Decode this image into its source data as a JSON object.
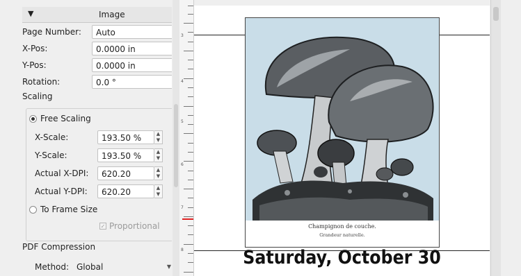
{
  "properties": {
    "section_title": "Image",
    "page_number_label": "Page Number:",
    "page_number_value": "Auto",
    "xpos_label": "X-Pos:",
    "xpos_value": "0.0000 in",
    "ypos_label": "Y-Pos:",
    "ypos_value": "0.0000 in",
    "rotation_label": "Rotation:",
    "rotation_value": "0.0 °",
    "scaling_label": "Scaling",
    "free_scaling_label": "Free Scaling",
    "xscale_label": "X-Scale:",
    "xscale_value": "193.50 %",
    "yscale_label": "Y-Scale:",
    "yscale_value": "193.50 %",
    "actual_xdpi_label": "Actual X-DPI:",
    "actual_xdpi_value": "620.20",
    "actual_ydpi_label": "Actual Y-DPI:",
    "actual_ydpi_value": "620.20",
    "to_frame_size_label": "To Frame Size",
    "proportional_label": "Proportional",
    "proportional_mark": "✓",
    "pdf_compression_label": "PDF Compression",
    "method_label": "Method:",
    "method_value": "Global"
  },
  "icons": {
    "collapse": "▼",
    "spin_up": "▲",
    "spin_down": "▼",
    "dropdown": "▼"
  },
  "ruler": {
    "labels": [
      "3",
      "4",
      "5",
      "6",
      "7",
      "8"
    ]
  },
  "document": {
    "caption_line1": "Champignon de couche.",
    "caption_line2": "Grandeur naturelle.",
    "date_text": "Saturday, October 30"
  },
  "colors": {
    "image_background": "#c9dde8",
    "ruler_marker": "#e02020"
  }
}
